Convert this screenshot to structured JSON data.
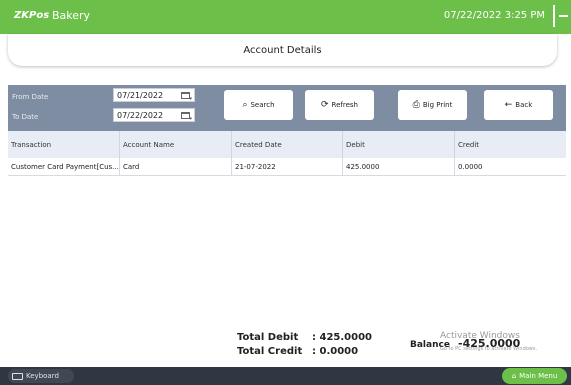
{
  "app": {
    "brand": "ZKPos",
    "title": "Bakery",
    "datetime": "07/22/2022 3:25 PM"
  },
  "page": {
    "title": "Account Details"
  },
  "filters": {
    "from_label": "From Date",
    "from_value": "07/21/2022",
    "to_label": "To Date",
    "to_value": "07/22/2022"
  },
  "buttons": {
    "search": "Search",
    "refresh": "Refresh",
    "big_print": "Big Print",
    "back": "Back"
  },
  "table": {
    "headers": [
      "Transaction",
      "Account Name",
      "Created Date",
      "Debit",
      "Credit"
    ],
    "rows": [
      [
        "Customer Card Payment[Cus...",
        "Card",
        "21-07-2022",
        "425.0000",
        "0.0000"
      ]
    ]
  },
  "totals": {
    "debit_label": "Total Debit",
    "debit_value": ": 425.0000",
    "credit_label": "Total Credit",
    "credit_value": ": 0.0000",
    "balance_label": "Balance",
    "balance_value": "-425.0000"
  },
  "watermark": {
    "line1": "Activate Windows",
    "line2": "Go to PC settings to activate Windows."
  },
  "bottom": {
    "keyboard": "Keyboard",
    "main_menu": "Main Menu"
  },
  "colors": {
    "accent": "#6cc04a",
    "filterbar": "#7f8da3",
    "table_header": "#e8edf5",
    "bottombar": "#2f3742"
  },
  "icons": {
    "search": "search-icon",
    "refresh": "refresh-icon",
    "print": "print-icon",
    "back": "back-arrow-icon",
    "calendar": "calendar-icon",
    "keyboard": "keyboard-icon",
    "home": "home-icon"
  }
}
